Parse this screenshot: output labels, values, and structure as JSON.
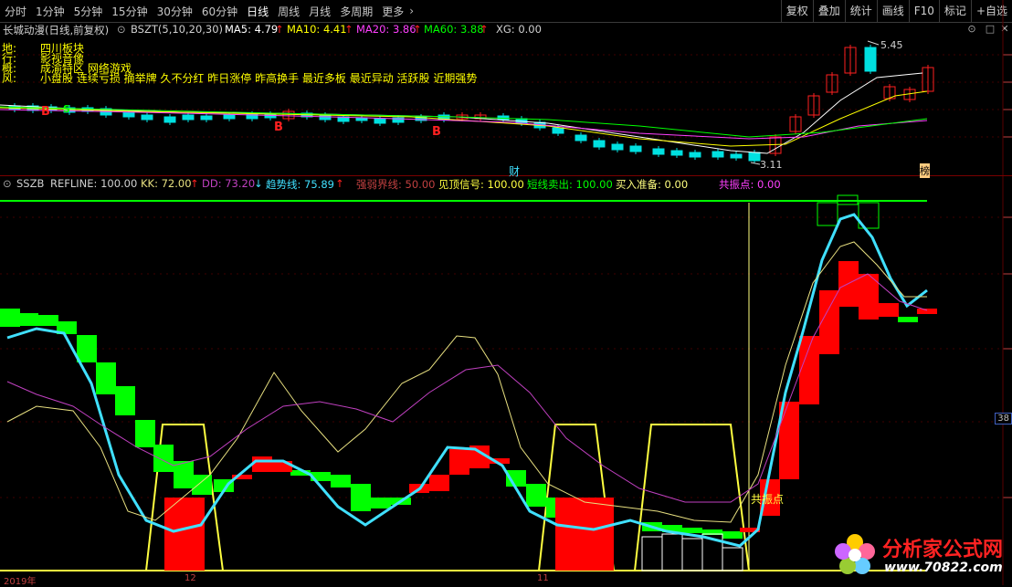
{
  "toolbar": {
    "periods": [
      "分时",
      "1分钟",
      "5分钟",
      "15分钟",
      "30分钟",
      "60分钟",
      "日线",
      "周线",
      "月线",
      "多周期",
      "更多"
    ],
    "active_period": "日线",
    "right_buttons": [
      "复权",
      "叠加",
      "统计",
      "画线",
      "F10",
      "标记",
      "+自选"
    ]
  },
  "main_chart": {
    "stock_name": "长城动漫(日线,前复权)",
    "indicator_name": "BSZT(5,10,20,30)",
    "ma5": "MA5: 4.79",
    "ma10": "MA10: 4.41",
    "ma20": "MA20: 3.86",
    "ma60": "MA60: 3.88",
    "xg": "XG: 0.00",
    "high_label": "5.45",
    "low_label": "3.11",
    "b_mark": "B",
    "s_mark": "S",
    "cai_mark": "财",
    "bang_mark": "榜",
    "info_lines": [
      {
        "key": "地:",
        "value": "四川板块"
      },
      {
        "key": "行:",
        "value": "影视音像"
      },
      {
        "key": "概:",
        "value": "成渝特区 网络游戏"
      },
      {
        "key": "风:",
        "value": "小盘股 连续亏损 摘举牌 久不分红 昨日涨停 昨高换手 最近多板 最近异动 活跃股 近期强势"
      }
    ],
    "colors": {
      "up": "#ff2020",
      "down": "#00e0e0",
      "ma5": "#ffffff",
      "ma10": "#ffff00",
      "ma20": "#ff40ff",
      "ma60": "#00ff00"
    }
  },
  "indicator_chart": {
    "name": "SSZB",
    "refline": "REFLINE: 100.00",
    "kk": "KK: 72.00",
    "dd": "DD: 73.20",
    "trend": "趋势线: 75.89",
    "strong_weak": "强弱界线: 50.00",
    "top_signal": "见顶信号: 100.00",
    "short_sell": "短线卖出: 100.00",
    "buy_ready": "买入准备: 0.00",
    "resonance": "共振点: 0.00",
    "resonance_marker": "共振点",
    "y_tag": "38",
    "colors": {
      "red_bar": "#ff0000",
      "green_bar": "#00ff00",
      "trend": "#40e0ff",
      "kk": "#e8e080",
      "dd": "#c040c0",
      "yellow": "#ffff40",
      "refline": "#00ff00"
    }
  },
  "bottom_axis": {
    "labels": [
      "2019年",
      "12",
      "11"
    ]
  },
  "watermark": {
    "title": "分析家公式网",
    "url": "www.70822.com"
  }
}
